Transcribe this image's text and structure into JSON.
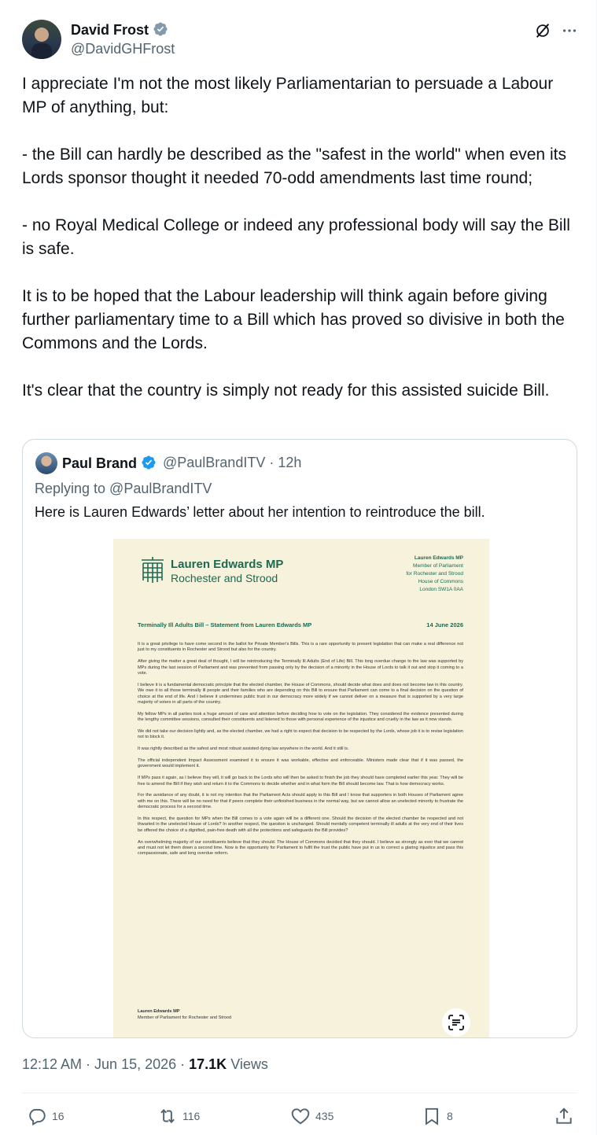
{
  "tweet": {
    "author_name": "David Frost",
    "author_handle": "@DavidGHFrost",
    "text": "I appreciate I'm not the most likely Parliamentarian to persuade a Labour MP of anything, but:\n\n- the Bill can hardly be described as the \"safest in the world\" when even its Lords sponsor thought it needed 70-odd amendments last time round;\n\n- no Royal Medical College or indeed any professional body will say the Bill is safe.\n\nIt is to be hoped that the Labour leadership will think again before giving further parliamentary time to a Bill which has proved so divisive in both the Commons and the Lords.\n\nIt's clear that the country is simply not ready for this assisted suicide Bill.",
    "time": "12:12 AM · Jun 15, 2026 · ",
    "views_count": "17.1K",
    "views_label": " Views"
  },
  "quote": {
    "author_name": "Paul Brand",
    "author_handle_time": "@PaulBrandITV · 12h",
    "replying_to": "Replying to @PaulBrandITV",
    "text": "Here is Lauren Edwards’ letter about her intention to reintroduce the bill."
  },
  "letter": {
    "name": "Lauren Edwards MP",
    "constituency": "Rochester and Strood",
    "address_name": "Lauren Edwards MP",
    "address_rest": "Member of Parliament\nfor Rochester and Strood\nHouse of Commons\nLondon SW1A 0AA",
    "title": "Terminally Ill Adults Bill – Statement from Lauren Edwards MP",
    "date": "14 June 2026",
    "paragraphs": [
      "It is a great privilege to have come second in the ballot for Private Member's Bills. This is a rare opportunity to present legislation that can make a real difference not just to my constituents in Rochester and Strood but also for the country.",
      "After giving the matter a great deal of thought, I will be reintroducing the Terminally Ill Adults (End of Life) Bill. This long overdue change to the law was supported by MPs during the last session of Parliament and was prevented from passing only by the decision of a minority in the House of Lords to talk it out and stop it coming to a vote.",
      "I believe it is a fundamental democratic principle that the elected chamber, the House of Commons, should decide what does and does not become law in this country. We owe it to all those terminally ill people and their families who are depending on this Bill to ensure that Parliament can come to a final decision on the question of choice at the end of life. And I believe it undermines public trust in our democracy more widely if we cannot deliver on a measure that is supported by a very large majority of voters in all parts of the country.",
      "My fellow MPs in all parties took a huge amount of care and attention before deciding how to vote on the legislation. They considered the evidence presented during the lengthy committee sessions, consulted their constituents and listened to those with personal experience of the injustice and cruelty in the law as it now stands.",
      "We did not take our decision lightly and, as the elected chamber, we had a right to expect that decision to be respected by the Lords, whose job it is to revise legislation not to block it.",
      "It was rightly described as the safest and most robust assisted dying law anywhere in the world. And it still is.",
      "The official independent Impact Assessment examined it to ensure it was workable, effective and enforceable. Ministers made clear that if it was passed, the government would implement it.",
      "If MPs pass it again, as I believe they will, it will go back to the Lords who will then be asked to finish the job they should have completed earlier this year. They will be free to amend the Bill if they wish and return it to the Commons to decide whether and in what form the Bill should become law. That is how democracy works.",
      "For the avoidance of any doubt, it is not my intention that the Parliament Acts should apply to this Bill and I know that supporters in both Houses of Parliament agree with me on this. There will be no need for that if peers complete their unfinished business in the normal way, but we cannot allow an unelected minority to frustrate the democratic process for a second time.",
      "In this respect, the question for MPs when the Bill comes to a vote again will be a different one. Should the decision of the elected chamber be respected and not thwarted in the unelected House of Lords? In another respect, the question is unchanged. Should mentally competent terminally ill adults at the very end of their lives be offered the choice of a dignified, pain-free death with all the protections and safeguards the Bill provides?",
      "An overwhelming majority of our constituents believe that they should. The House of Commons decided that they should. I believe as strongly as ever that we cannot and must not let them down a second time. Now is the opportunity for Parliament to fulfil the trust the public have put in us to correct a glaring injustice and pass this compassionate, safe and long overdue reform."
    ],
    "sign_name": "Lauren Edwards MP",
    "sign_role": "Member of Parliament for Rochester and Strood"
  },
  "actions": {
    "replies": "16",
    "reposts": "116",
    "likes": "435",
    "bookmarks": "8"
  },
  "colors": {
    "verified_gold": "#829aab",
    "verified_blue": "#1d9bf0",
    "letter_green": "#1c6a52",
    "muted_text": "#536471"
  },
  "icons": [
    "verified-badge-icon",
    "grok-icon",
    "more-icon",
    "scan-text-icon",
    "reply-icon",
    "repost-icon",
    "like-icon",
    "bookmark-icon",
    "share-icon"
  ]
}
